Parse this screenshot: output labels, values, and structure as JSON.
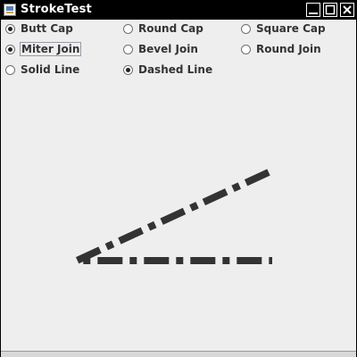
{
  "window": {
    "title": "StrokeTest",
    "icon": "app-icon",
    "controls": [
      "minimize-icon",
      "maximize-icon",
      "close-icon"
    ]
  },
  "cap_options": [
    {
      "label": "Butt Cap",
      "checked": true
    },
    {
      "label": "Round Cap",
      "checked": false
    },
    {
      "label": "Square Cap",
      "checked": false
    }
  ],
  "join_options": [
    {
      "label": "Miter Join",
      "checked": true,
      "focused": true
    },
    {
      "label": "Bevel Join",
      "checked": false
    },
    {
      "label": "Round Join",
      "checked": false
    }
  ],
  "line_options": [
    {
      "label": "Solid Line",
      "checked": false
    },
    {
      "label": "Dashed Line",
      "checked": true
    }
  ],
  "colors": {
    "window_bg": "#eeeeee",
    "titlebar": "#000000",
    "stroke": "#333333"
  }
}
